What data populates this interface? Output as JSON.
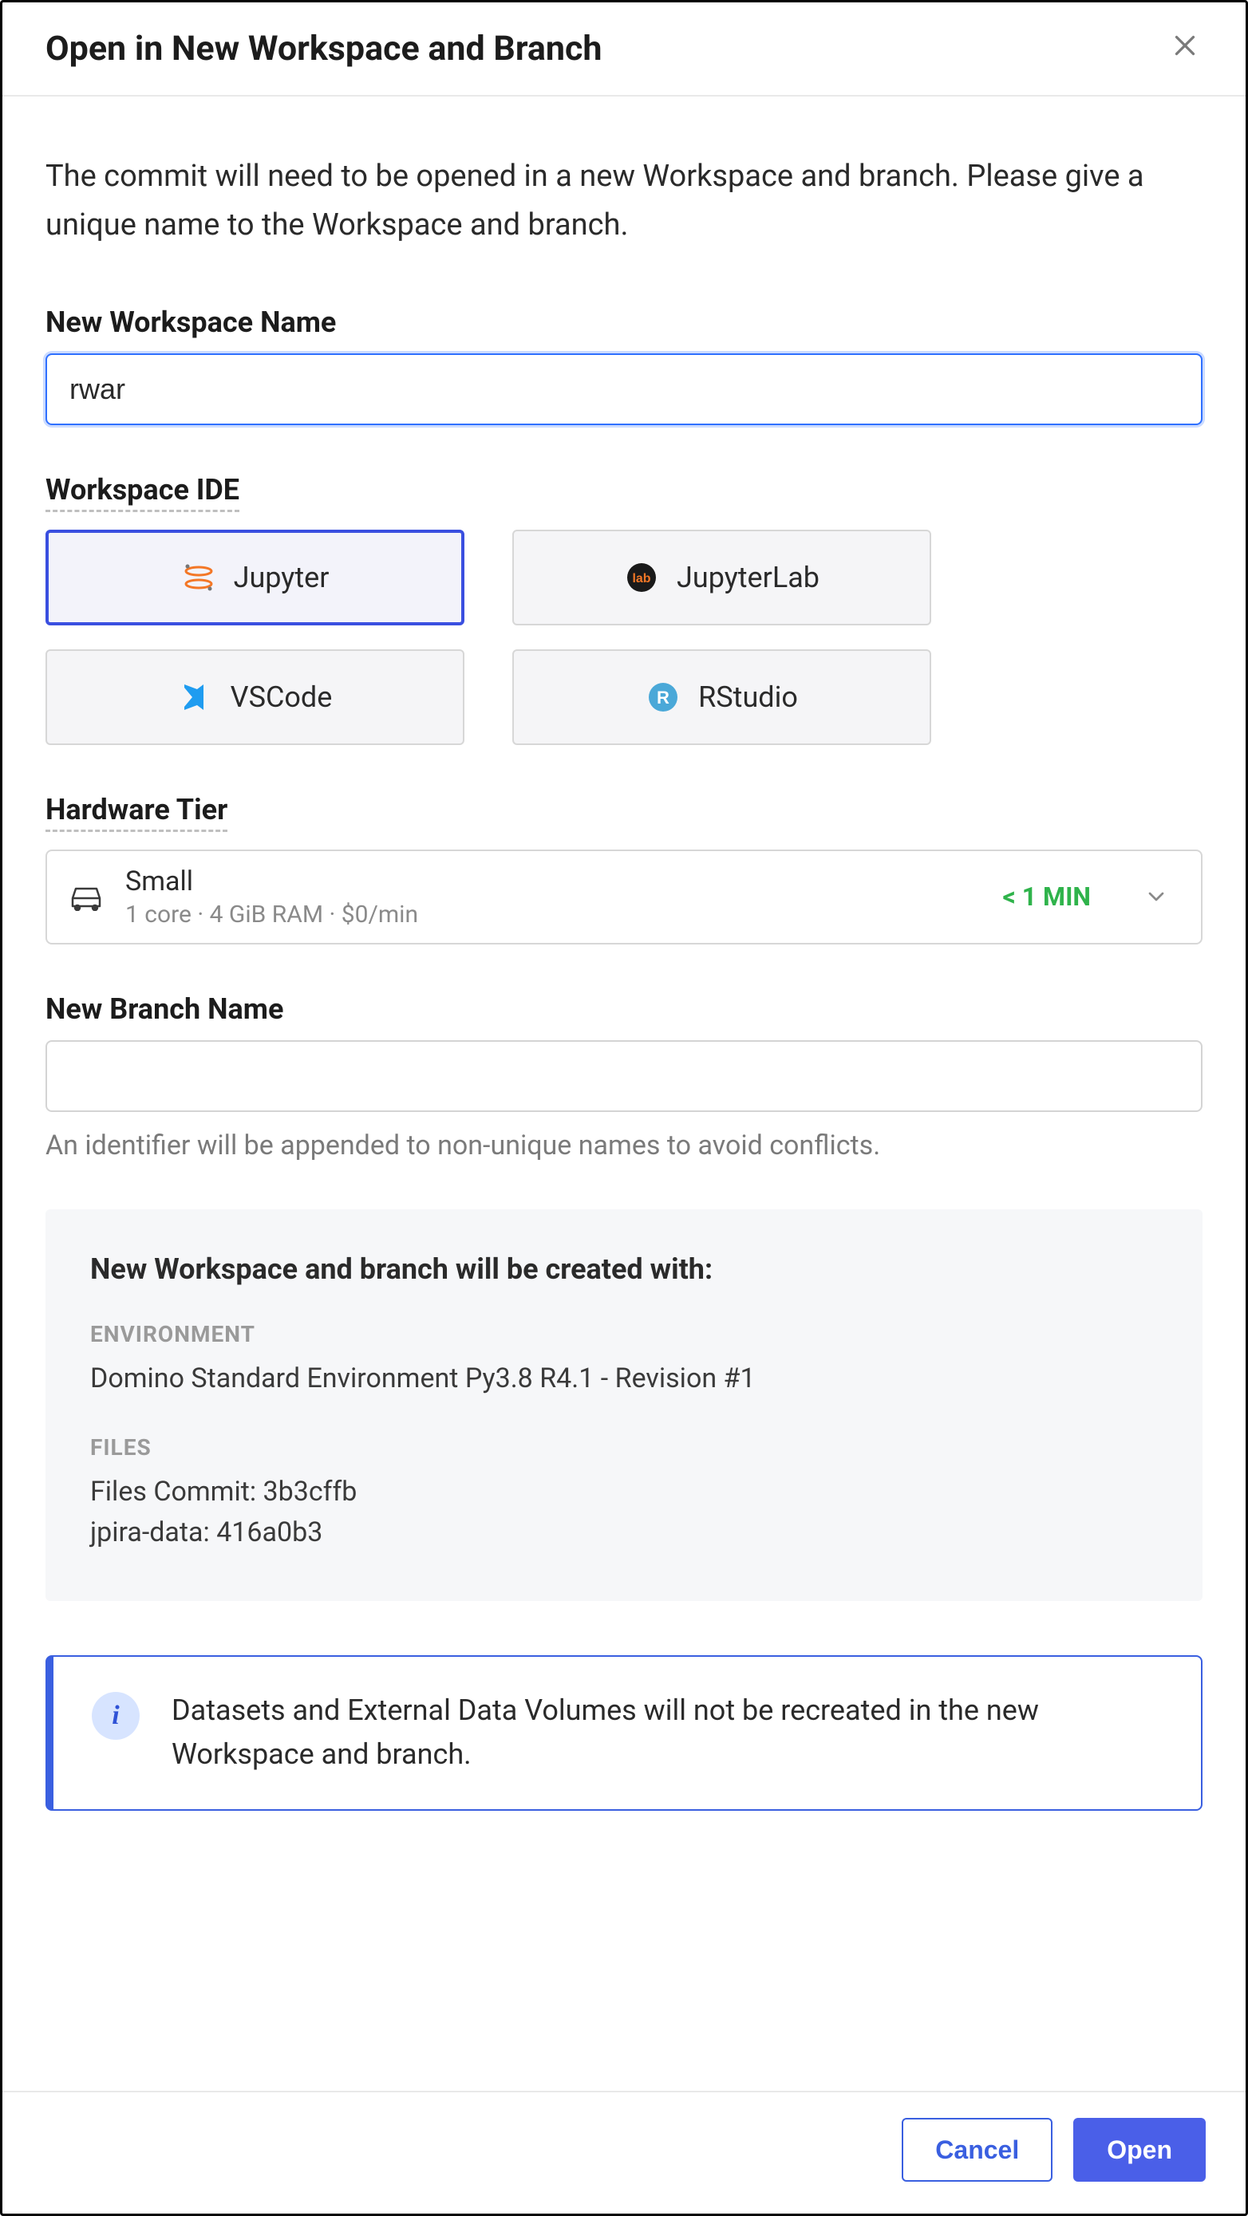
{
  "dialog": {
    "title": "Open in New Workspace and Branch",
    "intro": "The commit will need to be opened in a new Workspace and branch. Please give a unique name to the Workspace and branch."
  },
  "workspace_name": {
    "label": "New Workspace Name",
    "value": "rwar"
  },
  "ide": {
    "label": "Workspace IDE",
    "options": [
      {
        "label": "Jupyter",
        "selected": true
      },
      {
        "label": "JupyterLab",
        "selected": false
      },
      {
        "label": "VSCode",
        "selected": false
      },
      {
        "label": "RStudio",
        "selected": false
      }
    ]
  },
  "hardware": {
    "label": "Hardware Tier",
    "name": "Small",
    "meta": "1 core · 4 GiB RAM · $0/min",
    "time": "< 1 MIN"
  },
  "branch": {
    "label": "New Branch Name",
    "value": "",
    "helper": "An identifier will be appended to non-unique names to avoid conflicts."
  },
  "summary": {
    "title": "New Workspace and branch will be created with:",
    "env_label": "ENVIRONMENT",
    "env_value": "Domino Standard Environment Py3.8 R4.1 - Revision #1",
    "files_label": "FILES",
    "files_commit": "Files Commit: 3b3cffb",
    "files_data": "jpira-data: 416a0b3"
  },
  "info_banner": "Datasets and External Data Volumes will not be recreated in the new Workspace and branch.",
  "footer": {
    "cancel": "Cancel",
    "open": "Open"
  }
}
